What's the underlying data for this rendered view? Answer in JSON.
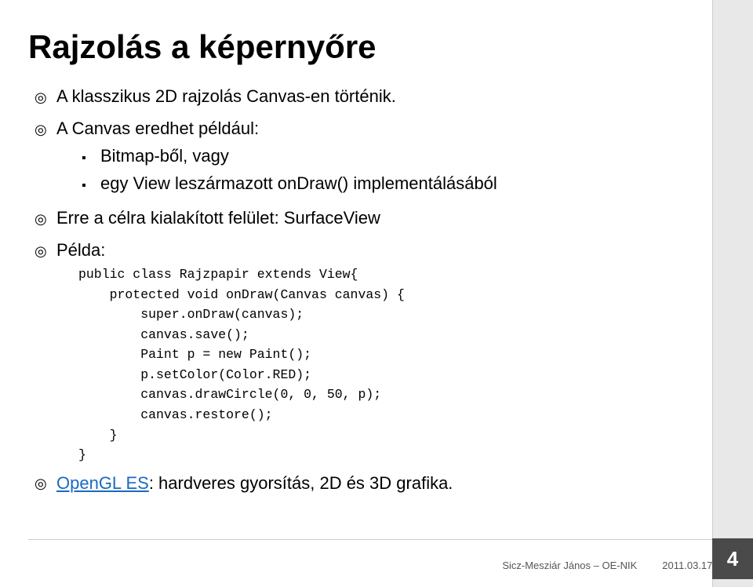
{
  "slide": {
    "title": "Rajzolás a képernyőre",
    "bullets": [
      {
        "id": "bullet1",
        "icon": "circle-dot",
        "text": "A klasszikus 2D rajzolás Canvas-en történik."
      },
      {
        "id": "bullet2",
        "icon": "circle-dot",
        "text": "A Canvas eredhet például:",
        "subbullets": [
          {
            "id": "sub1",
            "text": "Bitmap-ből, vagy"
          },
          {
            "id": "sub2",
            "text": "egy View leszármazott onDraw() implementálásából"
          }
        ]
      },
      {
        "id": "bullet3",
        "icon": "circle-dot",
        "text": "Erre a célra kialakított felület: SurfaceView"
      },
      {
        "id": "bullet4",
        "icon": "circle-dot",
        "text": "Példa:",
        "code": "public class Rajzpapir extends View{\n    protected void onDraw(Canvas canvas) {\n        super.onDraw(canvas);\n        canvas.save();\n        Paint p = new Paint();\n        p.setColor(Color.RED);\n        canvas.drawCircle(0, 0, 50, p);\n        canvas.restore();\n    }\n}"
      }
    ],
    "footer_bullet": {
      "icon": "circle-dot",
      "link_text": "OpenGL ES",
      "rest_text": ": hardveres gyorsítás, 2D és 3D grafika."
    },
    "footer": {
      "author": "Sicz-Mesziár János – OE-NIK",
      "date": "2011.03.17."
    },
    "slide_number": "4"
  }
}
